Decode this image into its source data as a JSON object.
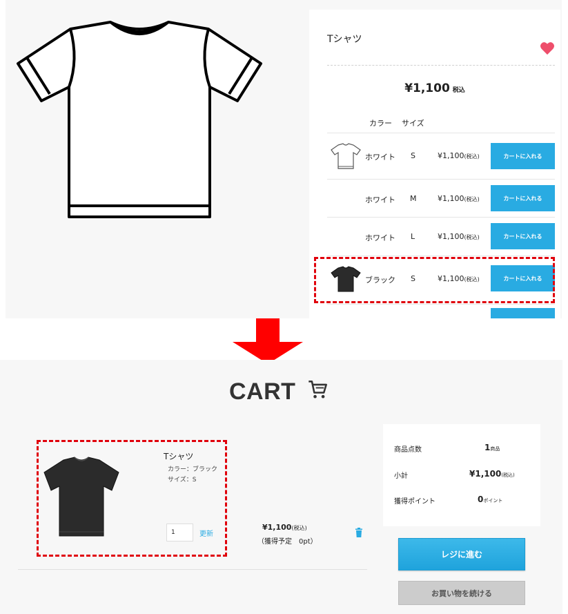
{
  "product": {
    "name": "Tシャツ",
    "price": "¥1,100",
    "tax_label": "税込",
    "headers": {
      "color": "カラー",
      "size": "サイズ"
    },
    "variants": [
      {
        "color": "ホワイト",
        "size": "S",
        "price": "¥1,100",
        "tax": "(税込)",
        "button": "カートに入れる",
        "thumb": "white-tshirt-icon"
      },
      {
        "color": "ホワイト",
        "size": "M",
        "price": "¥1,100",
        "tax": "(税込)",
        "button": "カートに入れる",
        "thumb": ""
      },
      {
        "color": "ホワイト",
        "size": "L",
        "price": "¥1,100",
        "tax": "(税込)",
        "button": "カートに入れる",
        "thumb": ""
      },
      {
        "color": "ブラック",
        "size": "S",
        "price": "¥1,100",
        "tax": "(税込)",
        "button": "カートに入れる",
        "thumb": "black-tshirt-icon"
      }
    ]
  },
  "cart": {
    "title": "CART",
    "item": {
      "name": "Tシャツ",
      "color_line": "カラー：ブラック",
      "size_line": "サイズ：S",
      "quantity": "1",
      "update_label": "更新",
      "price": "¥1,100",
      "tax": "(税込)",
      "points": "（獲得予定　0pt）"
    },
    "summary": {
      "count_label": "商品点数",
      "count_value": "1",
      "count_unit": "商品",
      "subtotal_label": "小計",
      "subtotal_value": "¥1,100",
      "subtotal_unit": "(税込)",
      "points_label": "獲得ポイント",
      "points_value": "0",
      "points_unit": "ポイント"
    },
    "checkout_label": "レジに進む",
    "continue_label": "お買い物を続ける"
  },
  "colors": {
    "accent": "#29abe2",
    "highlight": "#e0000b",
    "heart": "#ee4e6b",
    "arrow": "#ff0000"
  }
}
